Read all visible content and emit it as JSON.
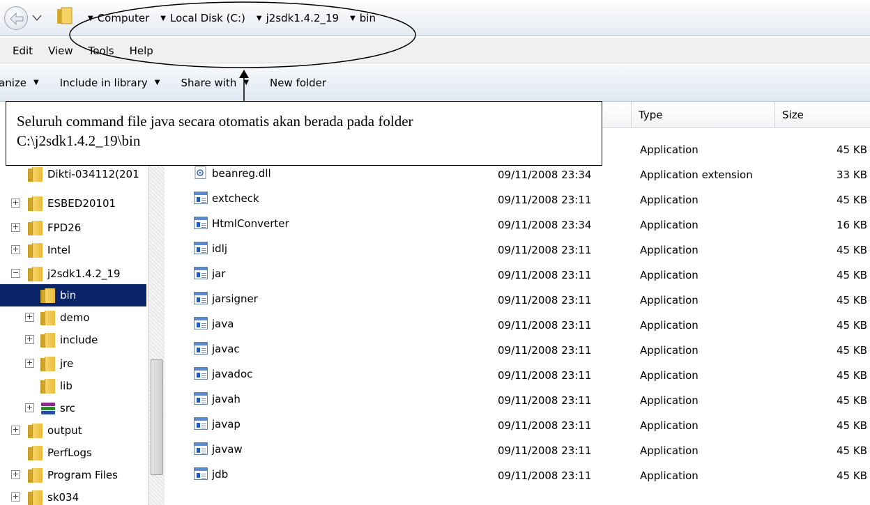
{
  "address_bar": {
    "breadcrumbs": [
      "Computer",
      "Local Disk (C:)",
      "j2sdk1.4.2_19",
      "bin"
    ]
  },
  "menu": [
    "Edit",
    "View",
    "Tools",
    "Help"
  ],
  "toolbar": {
    "organize_label": "anize",
    "include_label": "Include in library",
    "share_label": "Share with",
    "new_folder_label": "New folder"
  },
  "callout": {
    "line1": "Seluruh command file java secara otomatis akan berada pada folder",
    "line2": "C:\\j2sdk1.4.2_19\\bin"
  },
  "columns": {
    "type": "Type",
    "size": "Size"
  },
  "nav": [
    {
      "label": "Dikti-034112(201",
      "expander": ""
    },
    {
      "label": "ESBED20101",
      "expander": "+"
    },
    {
      "label": "FPD26",
      "expander": "+"
    },
    {
      "label": "Intel",
      "expander": "+"
    },
    {
      "label": "j2sdk1.4.2_19",
      "expander": "−"
    },
    {
      "label": "bin",
      "expander": ""
    },
    {
      "label": "demo",
      "expander": "+"
    },
    {
      "label": "include",
      "expander": "+"
    },
    {
      "label": "jre",
      "expander": "+"
    },
    {
      "label": "lib",
      "expander": ""
    },
    {
      "label": "src",
      "expander": "+"
    },
    {
      "label": "output",
      "expander": "+"
    },
    {
      "label": "PerfLogs",
      "expander": ""
    },
    {
      "label": "Program Files",
      "expander": "+"
    },
    {
      "label": "sk034",
      "expander": "+"
    }
  ],
  "files": [
    {
      "name": "",
      "date": "",
      "type": "Application",
      "size": "45 KB"
    },
    {
      "name": "beanreg.dll",
      "date": "09/11/2008 23:34",
      "type": "Application extension",
      "size": "33 KB"
    },
    {
      "name": "extcheck",
      "date": "09/11/2008 23:11",
      "type": "Application",
      "size": "45 KB"
    },
    {
      "name": "HtmlConverter",
      "date": "09/11/2008 23:34",
      "type": "Application",
      "size": "16 KB"
    },
    {
      "name": "idlj",
      "date": "09/11/2008 23:11",
      "type": "Application",
      "size": "45 KB"
    },
    {
      "name": "jar",
      "date": "09/11/2008 23:11",
      "type": "Application",
      "size": "45 KB"
    },
    {
      "name": "jarsigner",
      "date": "09/11/2008 23:11",
      "type": "Application",
      "size": "45 KB"
    },
    {
      "name": "java",
      "date": "09/11/2008 23:11",
      "type": "Application",
      "size": "45 KB"
    },
    {
      "name": "javac",
      "date": "09/11/2008 23:11",
      "type": "Application",
      "size": "45 KB"
    },
    {
      "name": "javadoc",
      "date": "09/11/2008 23:11",
      "type": "Application",
      "size": "45 KB"
    },
    {
      "name": "javah",
      "date": "09/11/2008 23:11",
      "type": "Application",
      "size": "45 KB"
    },
    {
      "name": "javap",
      "date": "09/11/2008 23:11",
      "type": "Application",
      "size": "45 KB"
    },
    {
      "name": "javaw",
      "date": "09/11/2008 23:11",
      "type": "Application",
      "size": "45 KB"
    },
    {
      "name": "jdb",
      "date": "09/11/2008 23:11",
      "type": "Application",
      "size": "45 KB"
    }
  ],
  "icons": {
    "back": "back-arrow-icon",
    "folder": "folder-icon",
    "application": "application-icon",
    "dll": "dll-icon",
    "archive": "winrar-icon"
  },
  "colors": {
    "selection": "#0a246a",
    "annotation": "#000000"
  }
}
